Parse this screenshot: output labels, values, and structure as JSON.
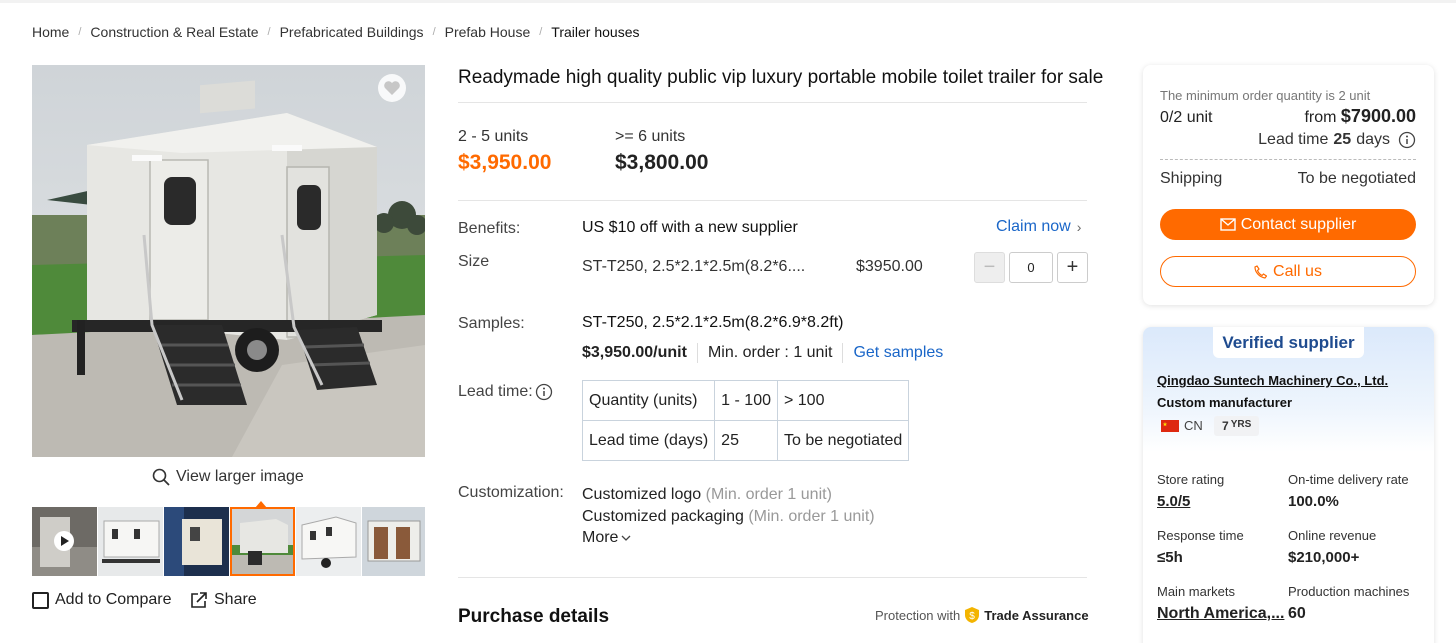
{
  "breadcrumb": [
    "Home",
    "Construction & Real Estate",
    "Prefabricated Buildings",
    "Prefab House",
    "Trailer houses"
  ],
  "gallery": {
    "view_larger": "View larger image",
    "add_to_compare": "Add to Compare",
    "share": "Share",
    "selected_thumb": 4
  },
  "product": {
    "title": "Readymade high quality public vip luxury portable mobile toilet trailer for sale",
    "tiers": [
      {
        "qty": "2 - 5 units",
        "price": "$3,950.00"
      },
      {
        "qty": ">= 6 units",
        "price": "$3,800.00"
      }
    ],
    "benefits_label": "Benefits:",
    "benefits_text": "US $10 off with a new supplier",
    "claim": "Claim now",
    "size_label": "Size",
    "size_value": "ST-T250, 2.5*2.1*2.5m(8.2*6....",
    "size_price": "$3950.00",
    "quantity": "0",
    "samples_label": "Samples:",
    "samples_value": "ST-T250, 2.5*2.1*2.5m(8.2*6.9*8.2ft)",
    "sample_price": "$3,950.00/unit",
    "sample_min": "Min. order : 1 unit",
    "get_samples": "Get samples",
    "lead_label": "Lead time:",
    "lead_table": {
      "row1": [
        "Quantity (units)",
        "1 - 100",
        "> 100"
      ],
      "row2": [
        "Lead time (days)",
        "25",
        "To be negotiated"
      ]
    },
    "custom_label": "Customization:",
    "custom_items": [
      {
        "name": "Customized logo",
        "note": "(Min. order 1 unit)"
      },
      {
        "name": "Customized packaging",
        "note": "(Min. order 1 unit)"
      }
    ],
    "more": "More",
    "purchase_details": "Purchase details",
    "protection": "Protection with",
    "trade_assurance": "Trade Assurance"
  },
  "order": {
    "min_note": "The minimum order quantity is 2 unit",
    "progress": "0/2 unit",
    "from_label": "from",
    "from_price": "$7900.00",
    "lead_prefix": "Lead time",
    "lead_days": "25",
    "lead_suffix": "days",
    "shipping_label": "Shipping",
    "shipping_value": "To be negotiated",
    "contact": "Contact supplier",
    "call": "Call us"
  },
  "supplier": {
    "badge": "Verified supplier",
    "name": "Qingdao Suntech Machinery Co., Ltd.",
    "type": "Custom manufacturer",
    "country": "CN",
    "years": "7",
    "years_unit": "YRS",
    "stats": [
      {
        "label": "Store rating",
        "value": "5.0/5"
      },
      {
        "label": "On-time delivery rate",
        "value": "100.0%"
      },
      {
        "label": "Response time",
        "value": "≤5h"
      },
      {
        "label": "Online revenue",
        "value": "$210,000+"
      },
      {
        "label": "Main markets",
        "value": "North America,..."
      },
      {
        "label": "Production machines",
        "value": "60"
      }
    ]
  },
  "colors": {
    "accent": "#ff6a00",
    "link": "#1a66c8",
    "verified": "#1e4b8f"
  }
}
